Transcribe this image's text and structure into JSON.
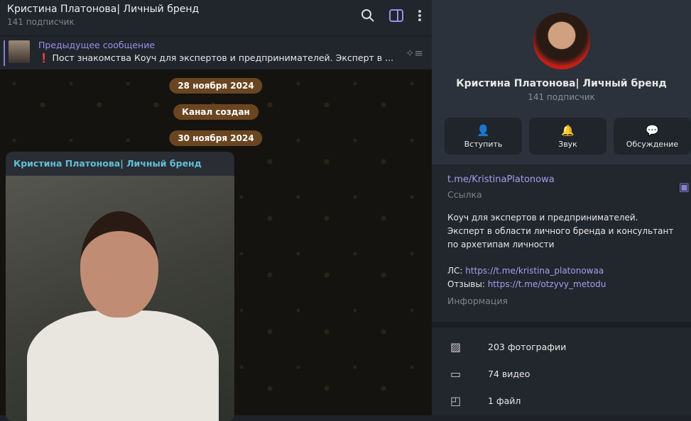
{
  "header": {
    "title": "Кристина Платонова| Личный бренд",
    "subtitle": "141 подписчик"
  },
  "pinned": {
    "label": "Предыдущее сообщение",
    "text": "❗ Пост знакомства   Коуч для экспертов и предпринимателей. Эксперт в ..."
  },
  "chat": {
    "dates": [
      "28 ноября 2024",
      "Канал создан",
      "30 ноября 2024"
    ],
    "message_author": "Кристина Платонова| Личный бренд"
  },
  "profile": {
    "name": "Кристина Платонова| Личный бренд",
    "subscribers": "141 подписчик",
    "buttons": [
      {
        "label": "Вступить",
        "icon": "user-add-icon"
      },
      {
        "label": "Звук",
        "icon": "bell-icon"
      },
      {
        "label": "Обсуждение",
        "icon": "chat-bubble-icon"
      }
    ],
    "link": "t.me/KristinaPlatonowa",
    "link_label": "Ссылка",
    "description": "Коуч для экспертов и предпринимателей. Эксперт в области личного бренда и консультант по архетипам личности",
    "dm_prefix": "ЛС: ",
    "dm_link": "https://t.me/kristina_platonowaa",
    "reviews_prefix": "Отзывы: ",
    "reviews_link": "https://t.me/otzyvy_metodu",
    "info_label": "Информация",
    "media": [
      {
        "label": "203 фотографии",
        "icon": "photo-icon"
      },
      {
        "label": "74 видео",
        "icon": "video-icon"
      },
      {
        "label": "1 файл",
        "icon": "file-icon"
      }
    ]
  }
}
